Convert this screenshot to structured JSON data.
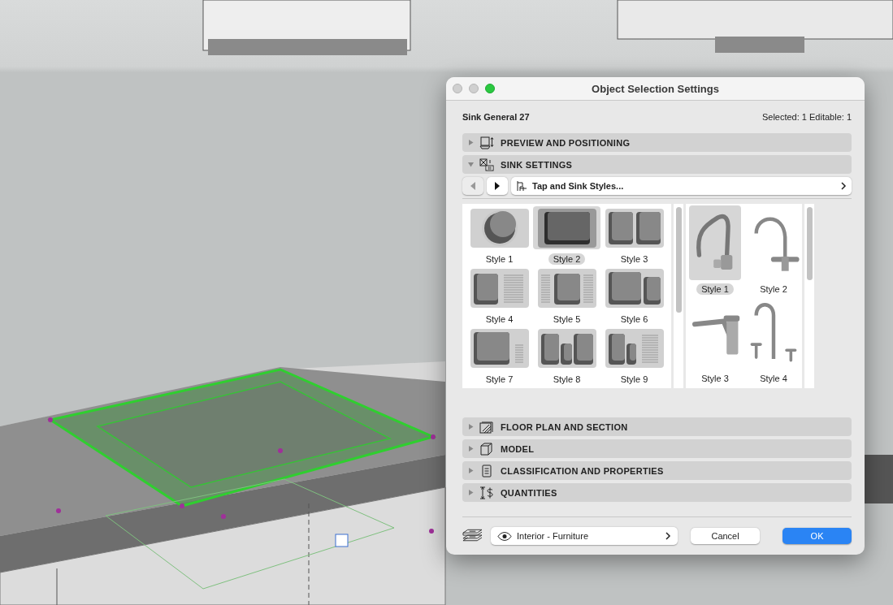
{
  "window": {
    "title": "Object Selection Settings"
  },
  "object_name": "Sink General 27",
  "selection_info": "Selected: 1 Editable: 1",
  "sections": [
    {
      "title": "PREVIEW AND POSITIONING",
      "expanded": false
    },
    {
      "title": "SINK SETTINGS",
      "expanded": true,
      "page_selector": "Tap and Sink Styles...",
      "sink_styles": [
        {
          "label": "Style 1",
          "selected": false
        },
        {
          "label": "Style 2",
          "selected": true
        },
        {
          "label": "Style 3",
          "selected": false
        },
        {
          "label": "Style 4",
          "selected": false
        },
        {
          "label": "Style 5",
          "selected": false
        },
        {
          "label": "Style 6",
          "selected": false
        },
        {
          "label": "Style 7",
          "selected": false
        },
        {
          "label": "Style 8",
          "selected": false
        },
        {
          "label": "Style 9",
          "selected": false
        }
      ],
      "tap_styles": [
        {
          "label": "Style 1",
          "selected": true
        },
        {
          "label": "Style 2",
          "selected": false
        },
        {
          "label": "Style 3",
          "selected": false
        },
        {
          "label": "Style 4",
          "selected": false
        }
      ]
    },
    {
      "title": "FLOOR PLAN AND SECTION",
      "expanded": false
    },
    {
      "title": "MODEL",
      "expanded": false
    },
    {
      "title": "CLASSIFICATION AND PROPERTIES",
      "expanded": false
    },
    {
      "title": "QUANTITIES",
      "expanded": false
    }
  ],
  "layer": "Interior - Furniture",
  "buttons": [
    {
      "label": "Cancel",
      "kind": "secondary"
    },
    {
      "label": "OK",
      "kind": "primary"
    }
  ]
}
